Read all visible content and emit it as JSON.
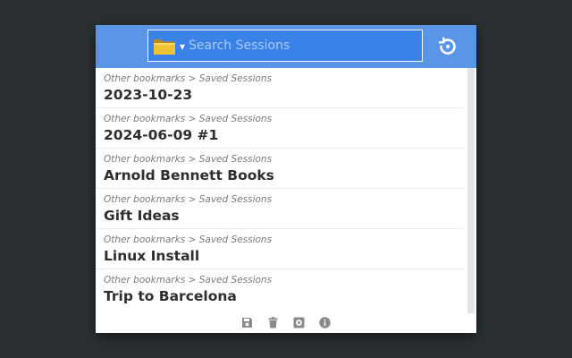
{
  "header": {
    "folder_icon": "folder-icon",
    "caret": "▾",
    "search_placeholder": "Search Sessions",
    "search_value": "",
    "restore_icon": "restore-icon",
    "accent_color": "#5b95e6",
    "search_bg_color": "#3a82e8"
  },
  "sessions": [
    {
      "path": "Other bookmarks > Saved Sessions",
      "title": "2023-10-23"
    },
    {
      "path": "Other bookmarks > Saved Sessions",
      "title": "2024-06-09 #1"
    },
    {
      "path": "Other bookmarks > Saved Sessions",
      "title": "Arnold Bennett Books"
    },
    {
      "path": "Other bookmarks > Saved Sessions",
      "title": "Gift Ideas"
    },
    {
      "path": "Other bookmarks > Saved Sessions",
      "title": "Linux Install"
    },
    {
      "path": "Other bookmarks > Saved Sessions",
      "title": "Trip to Barcelona"
    }
  ],
  "footer": {
    "icons": [
      "save-icon",
      "trash-icon",
      "settings-icon",
      "info-icon"
    ]
  }
}
